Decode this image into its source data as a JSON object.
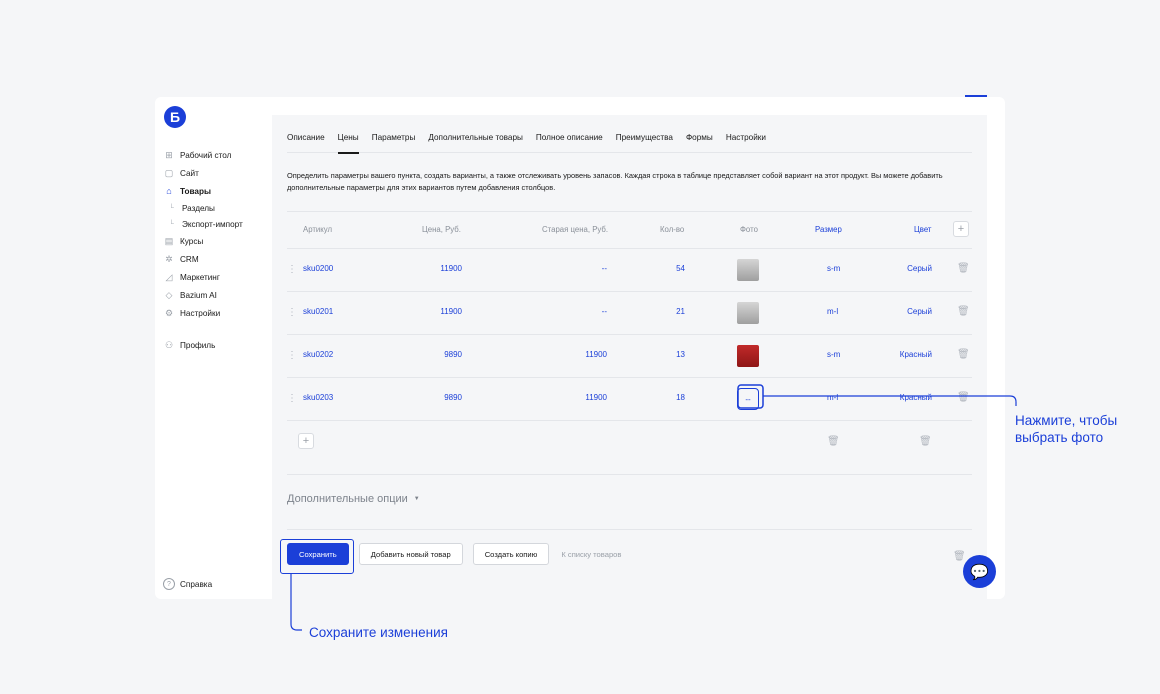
{
  "logo": "Б",
  "sidebar": {
    "items": [
      {
        "icon": "grid-icon",
        "glyph": "⊞",
        "label": "Рабочий стол"
      },
      {
        "icon": "site-icon",
        "glyph": "▢",
        "label": "Сайт"
      },
      {
        "icon": "bag-icon",
        "glyph": "⌂",
        "label": "Товары"
      }
    ],
    "subitems": [
      "Разделы",
      "Экспорт-импорт"
    ],
    "items2": [
      {
        "icon": "book-icon",
        "glyph": "▤",
        "label": "Курсы"
      },
      {
        "icon": "crm-icon",
        "glyph": "✲",
        "label": "CRM"
      },
      {
        "icon": "marketing-icon",
        "glyph": "◿",
        "label": "Маркетинг"
      },
      {
        "icon": "ai-icon",
        "glyph": "◇",
        "label": "Bazium AI"
      },
      {
        "icon": "settings-icon",
        "glyph": "⚙",
        "label": "Настройки"
      }
    ],
    "profile": {
      "icon": "user-icon",
      "glyph": "⚇",
      "label": "Профиль"
    },
    "help": "Справка"
  },
  "tabs": [
    "Описание",
    "Цены",
    "Параметры",
    "Дополнительные товары",
    "Полное описание",
    "Преимущества",
    "Формы",
    "Настройки"
  ],
  "active_tab": "Цены",
  "intro": "Определить параметры вашего пункта, создать варианты, а также отслеживать уровень запасов. Каждая строка в таблице представляет собой вариант на этот продукт. Вы можете добавить дополнительные параметры для этих вариантов путем добавления столбцов.",
  "table": {
    "headers": {
      "sku": "Артикул",
      "price": "Цена, Руб.",
      "old_price": "Старая цена, Руб.",
      "qty": "Кол-во",
      "photo": "Фото",
      "size": "Размер",
      "color": "Цвет"
    },
    "add_col": "+",
    "rows": [
      {
        "sku": "sku0200",
        "price": "11900",
        "old_price": "--",
        "qty": "54",
        "photo": "gray",
        "size": "s-m",
        "color": "Серый"
      },
      {
        "sku": "sku0201",
        "price": "11900",
        "old_price": "--",
        "qty": "21",
        "photo": "gray",
        "size": "m-l",
        "color": "Серый"
      },
      {
        "sku": "sku0202",
        "price": "9890",
        "old_price": "11900",
        "qty": "13",
        "photo": "red",
        "size": "s-m",
        "color": "Красный"
      },
      {
        "sku": "sku0203",
        "price": "9890",
        "old_price": "11900",
        "qty": "18",
        "photo": "--",
        "size": "m-l",
        "color": "Красный"
      }
    ],
    "add_row": "+"
  },
  "extra_options": "Дополнительные опции",
  "actions": {
    "save": "Сохранить",
    "add_new": "Добавить новый товар",
    "copy": "Создать копию",
    "to_list": "К списку товаров"
  },
  "callouts": {
    "photo": "Нажмите, чтобы выбрать фото",
    "photo_line1": "Нажмите, чтобы",
    "photo_line2": "выбрать фото",
    "save": "Сохраните изменения"
  },
  "colors": {
    "accent": "#1b3fd8",
    "background": "#f5f6f8"
  }
}
